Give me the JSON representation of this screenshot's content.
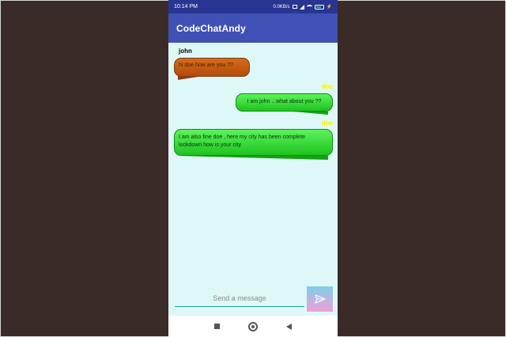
{
  "status_bar": {
    "time": "10:14 PM",
    "network_speed": "0.0KB/s",
    "icons": [
      "hd-icon",
      "signal-icon",
      "wifi-icon",
      "battery-icon",
      "charging-icon"
    ]
  },
  "app_bar": {
    "title": "CodeChatAndy"
  },
  "messages": [
    {
      "sender": "john",
      "text": "hi doe how are you ??",
      "side": "left",
      "bubble_color": "#d56418"
    },
    {
      "sender": "doe",
      "text": "I am john .. what about you ??",
      "side": "right",
      "bubble_color": "#2fd62f"
    },
    {
      "sender": "doe",
      "text": "I am also fine doe , here my city has been complete lockdown how is your city",
      "side": "right",
      "bubble_color": "#2fd62f"
    }
  ],
  "composer": {
    "placeholder": "Send a message",
    "value": "",
    "send_icon": "send-icon"
  },
  "nav_bar": {
    "icons": [
      "recent-apps-icon",
      "home-icon",
      "back-icon"
    ]
  },
  "colors": {
    "status_bar": "#283593",
    "app_bar": "#3f51b5",
    "chat_background": "#def8f8",
    "sender_doe": "#ffee00",
    "input_underline": "#26a69a"
  }
}
